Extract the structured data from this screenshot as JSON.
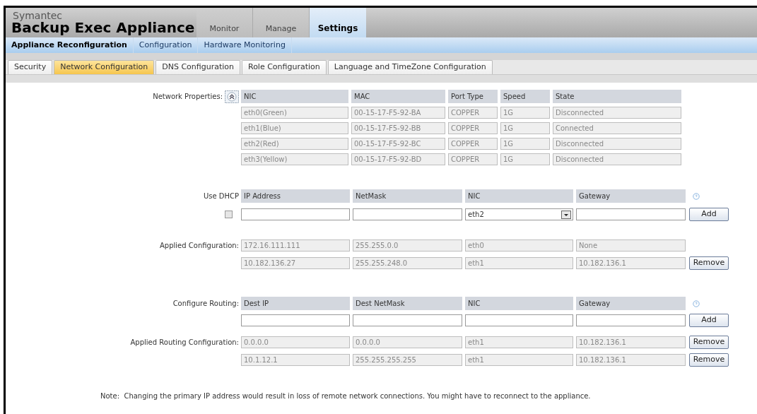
{
  "header": {
    "brand_small": "Symantec",
    "brand": "Backup Exec Appliance",
    "main_tabs": [
      {
        "label": "Monitor",
        "selected": false
      },
      {
        "label": "Manage",
        "selected": false
      },
      {
        "label": "Settings",
        "selected": true
      }
    ]
  },
  "sub_nav": [
    {
      "label": "Appliance Reconfiguration",
      "selected": true
    },
    {
      "label": "Configuration",
      "selected": false
    },
    {
      "label": "Hardware Monitoring",
      "selected": false
    }
  ],
  "tabs": [
    {
      "label": "Security",
      "selected": false
    },
    {
      "label": "Network Configuration",
      "selected": true
    },
    {
      "label": "DNS Configuration",
      "selected": false
    },
    {
      "label": "Role Configuration",
      "selected": false
    },
    {
      "label": "Language and TimeZone Configuration",
      "selected": false
    }
  ],
  "network_properties": {
    "label": "Network Properties:",
    "expanded": true,
    "columns": [
      "NIC",
      "MAC",
      "Port Type",
      "Speed",
      "State"
    ],
    "rows": [
      [
        "eth0(Green)",
        "00-15-17-F5-92-BA",
        "COPPER",
        "1G",
        "Disconnected"
      ],
      [
        "eth1(Blue)",
        "00-15-17-F5-92-BB",
        "COPPER",
        "1G",
        "Connected"
      ],
      [
        "eth2(Red)",
        "00-15-17-F5-92-BC",
        "COPPER",
        "1G",
        "Disconnected"
      ],
      [
        "eth3(Yellow)",
        "00-15-17-F5-92-BD",
        "COPPER",
        "1G",
        "Disconnected"
      ]
    ]
  },
  "dhcp": {
    "label": "Use DHCP",
    "checked": false,
    "columns": [
      "IP Address",
      "NetMask",
      "NIC",
      "Gateway"
    ],
    "nic_value": "eth2",
    "add_button": "Add"
  },
  "applied_configuration": {
    "label": "Applied Configuration:",
    "rows": [
      {
        "cells": [
          "172.16.111.111",
          "255.255.0.0",
          "eth0",
          "None"
        ]
      },
      {
        "cells": [
          "10.182.136.27",
          "255.255.248.0",
          "eth1",
          "10.182.136.1"
        ],
        "button": "Remove"
      }
    ]
  },
  "routing": {
    "label": "Configure Routing:",
    "columns": [
      "Dest IP",
      "Dest NetMask",
      "NIC",
      "Gateway"
    ],
    "add_button": "Add"
  },
  "applied_routing": {
    "label": "Applied Routing Configuration:",
    "rows": [
      {
        "cells": [
          "0.0.0.0",
          "0.0.0.0",
          "eth1",
          "10.182.136.1"
        ],
        "button": "Remove"
      },
      {
        "cells": [
          "10.1.12.1",
          "255.255.255.255",
          "eth1",
          "10.182.136.1"
        ],
        "button": "Remove"
      }
    ]
  },
  "note": "Note:  Changing the primary IP address would result in loss of remote network connections. You might have to reconnect to the appliance."
}
